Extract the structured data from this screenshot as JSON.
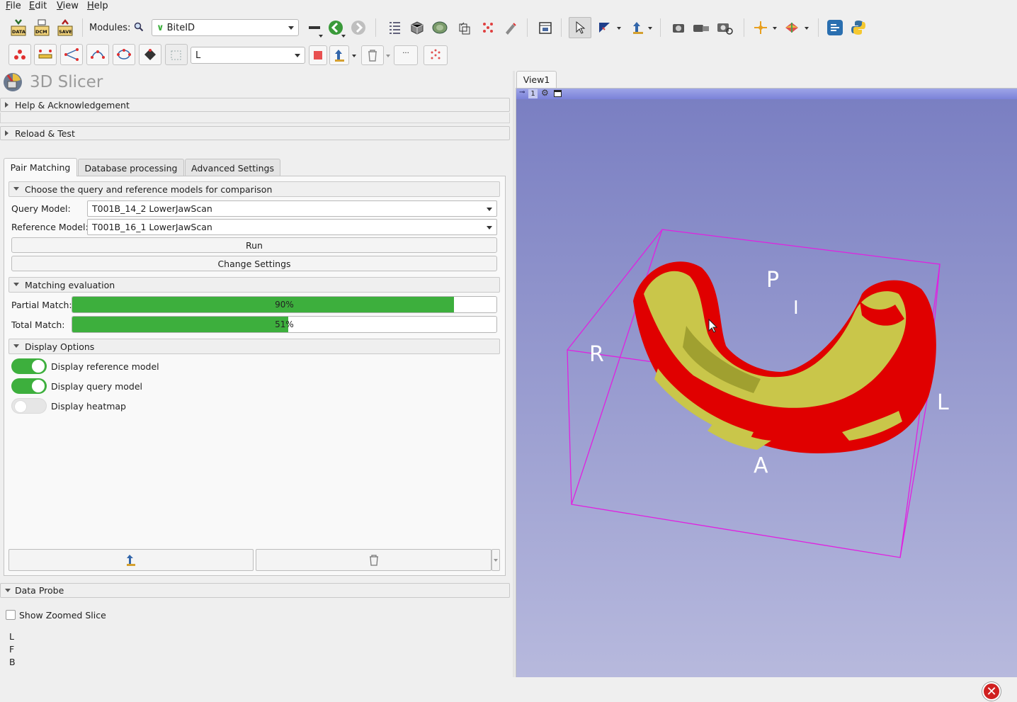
{
  "menu": [
    "File",
    "Edit",
    "View",
    "Help"
  ],
  "toolbar": {
    "modules_label": "Modules:",
    "module_selected": "BiteID",
    "data_label": "DATA",
    "dcm_label": "DCM",
    "save_label": "SAVE",
    "markup_selected": "L"
  },
  "panel": {
    "app_title": "3D Slicer",
    "help_section": "Help & Acknowledgement",
    "reload_section": "Reload & Test",
    "tabs": [
      "Pair Matching",
      "Database processing",
      "Advanced Settings"
    ],
    "choose_section": "Choose the query and reference models for comparison",
    "query_label": "Query Model:",
    "query_value": "T001B_14_2 LowerJawScan",
    "reference_label": "Reference Model:",
    "reference_value": "T001B_16_1 LowerJawScan",
    "run_label": "Run",
    "change_settings_label": "Change Settings",
    "eval_section": "Matching evaluation",
    "partial_label": "Partial Match:",
    "partial_value": 90,
    "partial_text": "90%",
    "total_label": "Total Match:",
    "total_value": 51,
    "total_text": "51%",
    "display_section": "Display Options",
    "display_reference": "Display reference model",
    "display_query": "Display query model",
    "display_heatmap": "Display heatmap",
    "toggles": {
      "reference": true,
      "query": true,
      "heatmap": false
    }
  },
  "data_probe": {
    "section": "Data Probe",
    "show_zoomed": "Show Zoomed Slice",
    "lines": [
      "L",
      "F",
      "B"
    ]
  },
  "view": {
    "tab": "View1",
    "number": "1",
    "labels": {
      "P": "P",
      "I": "I",
      "R": "R",
      "L": "L",
      "A": "A"
    }
  },
  "colors": {
    "accent_green": "#3daf3d",
    "view_top": "#7a7fc2",
    "view_bottom": "#b7b9dd",
    "query_model": "#c9c64a",
    "reference_model": "#e00000",
    "bbox": "#e020e0"
  }
}
